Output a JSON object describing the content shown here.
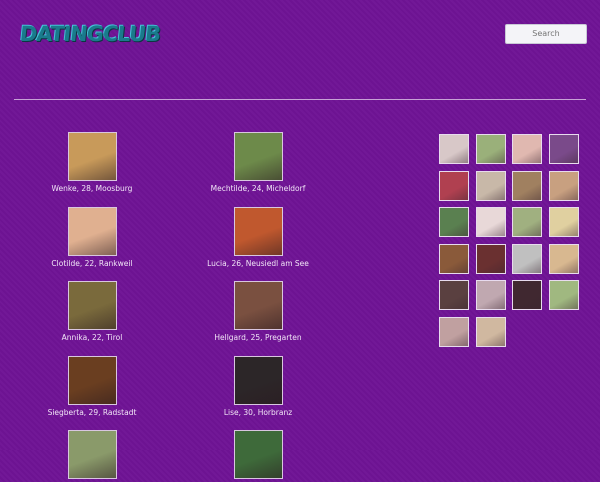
{
  "header": {
    "logo_text": "DATINGCLUB",
    "search_placeholder": "Search"
  },
  "colors": {
    "background": "#6f1395",
    "logo": "#1a7a8c"
  },
  "profiles": [
    {
      "caption": "Wenke, 28, Moosburg",
      "tone": "#c89a5a"
    },
    {
      "caption": "Mechtilde, 24, Micheldorf",
      "tone": "#6d8a4a"
    },
    {
      "caption": "Clotilde, 22, Rankweil",
      "tone": "#e0b090"
    },
    {
      "caption": "Lucia, 26, Neusiedl am See",
      "tone": "#c0582e"
    },
    {
      "caption": "Annika, 22, Tirol",
      "tone": "#7a6a3c"
    },
    {
      "caption": "Hellgard, 25, Pregarten",
      "tone": "#7a5040"
    },
    {
      "caption": "Siegberta, 29, Radstadt",
      "tone": "#6a3e20"
    },
    {
      "caption": "Lise, 30, Horbranz",
      "tone": "#2c2628"
    },
    {
      "caption": "",
      "tone": "#8a9a6a"
    },
    {
      "caption": "",
      "tone": "#3e6a3a"
    }
  ],
  "thumbnails": [
    "#d8c8c8",
    "#9ab07a",
    "#e0b8b0",
    "#7a4a8a",
    "#b04050",
    "#c8b8a8",
    "#a08060",
    "#c8a080",
    "#5a8050",
    "#e8d8d8",
    "#a0b080",
    "#e0d0a0",
    "#8a5a3a",
    "#6a3030",
    "#c0c0c0",
    "#d8b890",
    "#5a4040",
    "#c0a8b0",
    "#402830",
    "#a0b880",
    "#c0a0a0",
    "#d0b8a0"
  ]
}
